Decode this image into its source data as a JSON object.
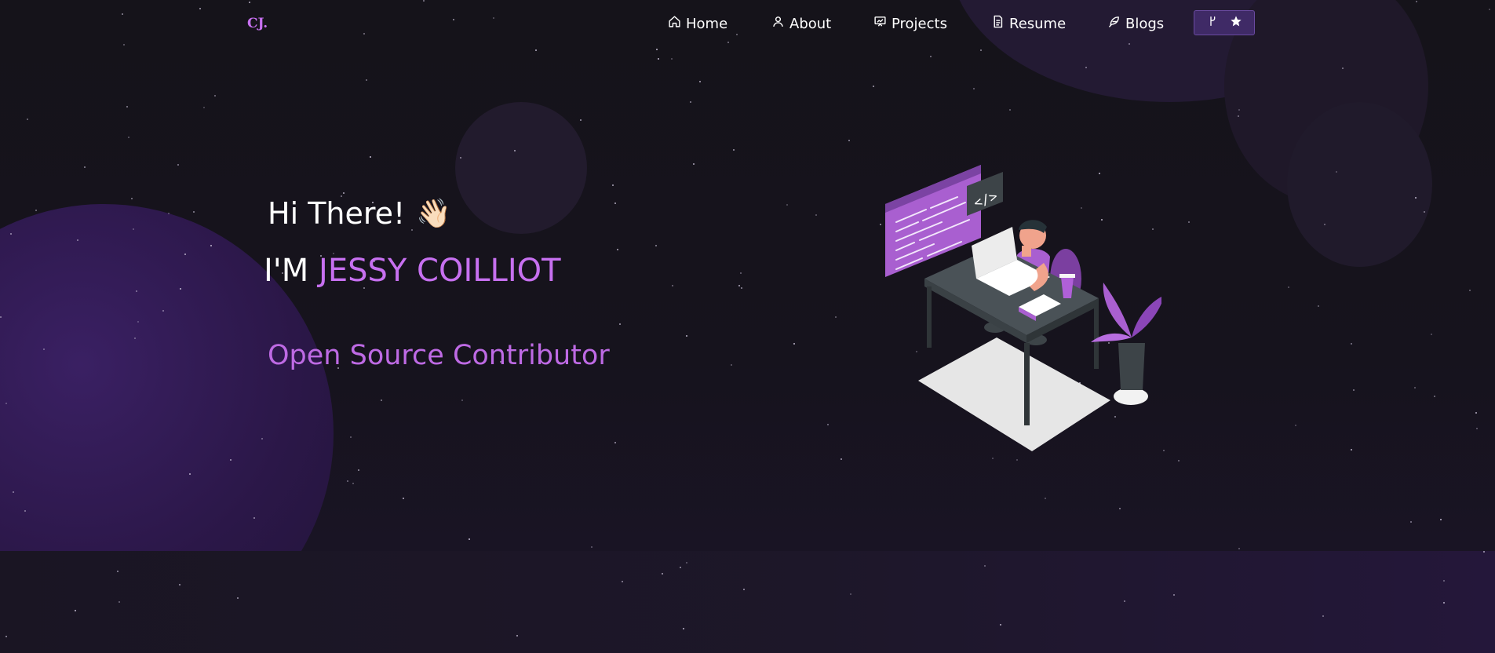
{
  "logo": {
    "text": "CJ."
  },
  "nav": {
    "items": [
      {
        "label": "Home",
        "icon": "home-icon"
      },
      {
        "label": "About",
        "icon": "user-icon"
      },
      {
        "label": "Projects",
        "icon": "presentation-icon"
      },
      {
        "label": "Resume",
        "icon": "document-icon"
      },
      {
        "label": "Blogs",
        "icon": "feather-icon"
      }
    ],
    "github_button": {
      "icons": [
        "git-fork-icon",
        "star-icon"
      ]
    }
  },
  "hero": {
    "greeting": "Hi There!",
    "wave_emoji": "👋🏻",
    "intro_prefix": "I'M ",
    "name": "JESSY COILLIOT",
    "role": "Open Source Contributor"
  },
  "colors": {
    "accent": "#c770f0",
    "background": "#16131c",
    "button_bg": "#3f2a66"
  }
}
